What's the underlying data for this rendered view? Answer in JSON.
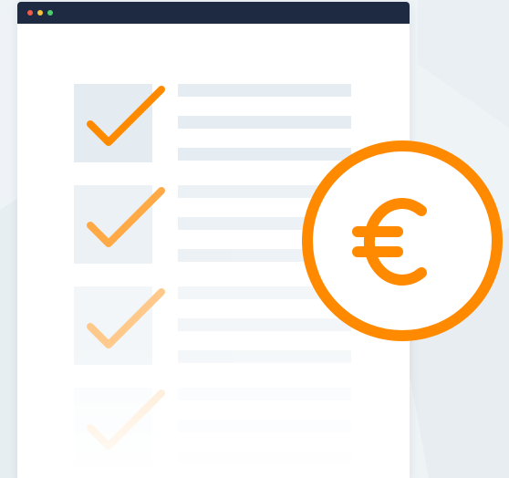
{
  "colors": {
    "background": "#eef3f6",
    "window_frame": "#1d2a42",
    "placeholder_line": "#e6edf2",
    "checkbox_fill": "#e4ecf1",
    "accent": "#ff8a00"
  },
  "window": {
    "titlebar_dots": [
      "#f25b4a",
      "#f5c33b",
      "#4ccf6b"
    ]
  },
  "checklist": {
    "items": [
      {
        "checked": true,
        "opacity": 1.0
      },
      {
        "checked": true,
        "opacity": 0.72
      },
      {
        "checked": true,
        "opacity": 0.45
      },
      {
        "checked": true,
        "opacity": 0.2
      }
    ]
  },
  "badge": {
    "icon": "euro-icon",
    "symbol": "€"
  }
}
